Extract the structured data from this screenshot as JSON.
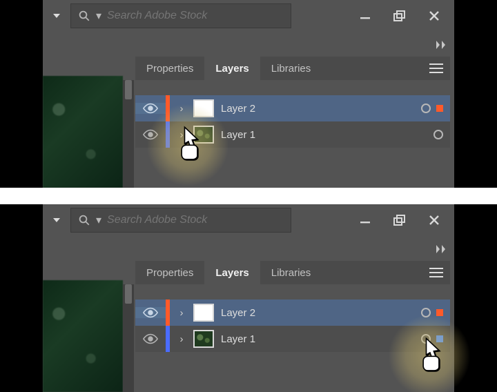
{
  "search": {
    "placeholder": "Search Adobe Stock"
  },
  "tabs": {
    "properties": "Properties",
    "layers": "Layers",
    "libraries": "Libraries"
  },
  "layers": [
    {
      "name": "Layer 2",
      "color": "#ff5a2a",
      "thumb": "white",
      "selected": true,
      "sq": "#ff5a2a"
    },
    {
      "name": "Layer 1",
      "color": "#4a6cff",
      "thumb": "img",
      "selected": false,
      "sq": null
    }
  ],
  "layers2": [
    {
      "name": "Layer 2",
      "color": "#ff5a2a",
      "thumb": "white",
      "selected": true,
      "sq": "#ff5a2a"
    },
    {
      "name": "Layer 1",
      "color": "#4a6cff",
      "thumb": "img",
      "selected": false,
      "sq": "#4a8cff"
    }
  ]
}
